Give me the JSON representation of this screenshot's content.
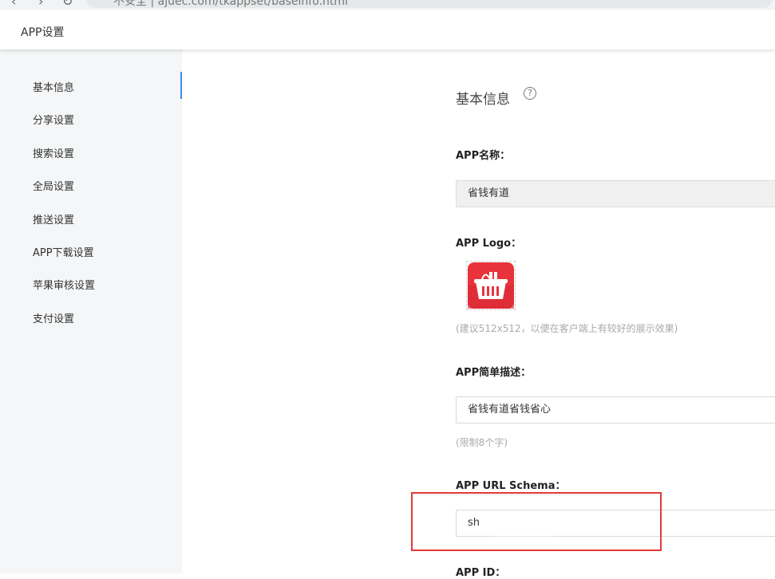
{
  "browser": {
    "url": "不安全 | ajuec.com/tkappset/baseinfo.html"
  },
  "header": {
    "title": "APP设置"
  },
  "sidebar": {
    "items": [
      {
        "label": "基本信息",
        "active": true
      },
      {
        "label": "分享设置"
      },
      {
        "label": "搜索设置"
      },
      {
        "label": "全局设置"
      },
      {
        "label": "推送设置"
      },
      {
        "label": "APP下载设置"
      },
      {
        "label": "苹果审核设置"
      },
      {
        "label": "支付设置"
      }
    ]
  },
  "main": {
    "section_title": "基本信息",
    "help_glyph": "?",
    "app_name": {
      "label": "APP名称：",
      "value": "省钱有道"
    },
    "app_logo": {
      "label": "APP Logo：",
      "hint": "(建议512x512，以便在客户端上有较好的展示效果)"
    },
    "app_desc": {
      "label": "APP简单描述：",
      "value": "省钱有道省钱省心",
      "hint": "(限制8个字)"
    },
    "app_url_schema": {
      "label": "APP URL Schema：",
      "value": "sh"
    },
    "app_id": {
      "label": "APP ID："
    }
  },
  "colors": {
    "accent": "#3a8ee6",
    "highlight": "#e23b3b",
    "logo_red": "#e8333c"
  }
}
